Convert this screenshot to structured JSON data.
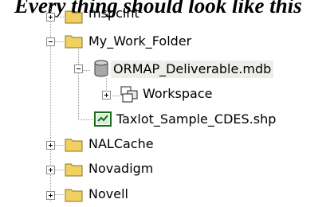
{
  "caption": "Every thing should look like this",
  "tree": {
    "items": [
      {
        "label": "mspclnt",
        "icon": "folder-icon",
        "expander": "plus"
      },
      {
        "label": "My_Work_Folder",
        "icon": "folder-open-icon",
        "expander": "minus"
      },
      {
        "label": "ORMAP_Deliverable.mdb",
        "icon": "database-icon",
        "expander": "minus",
        "selected": true
      },
      {
        "label": "Workspace",
        "icon": "workspace-icon",
        "expander": "plus"
      },
      {
        "label": "Taxlot_Sample_CDES.shp",
        "icon": "shapefile-icon",
        "expander": "none"
      },
      {
        "label": "NALCache",
        "icon": "folder-icon",
        "expander": "plus"
      },
      {
        "label": "Novadigm",
        "icon": "folder-icon",
        "expander": "plus"
      },
      {
        "label": "Novell",
        "icon": "folder-icon",
        "expander": "plus"
      }
    ]
  },
  "colors": {
    "folder": "#f0d060",
    "selected_bg": "#eeeee8",
    "connector": "#9a9a9a"
  }
}
